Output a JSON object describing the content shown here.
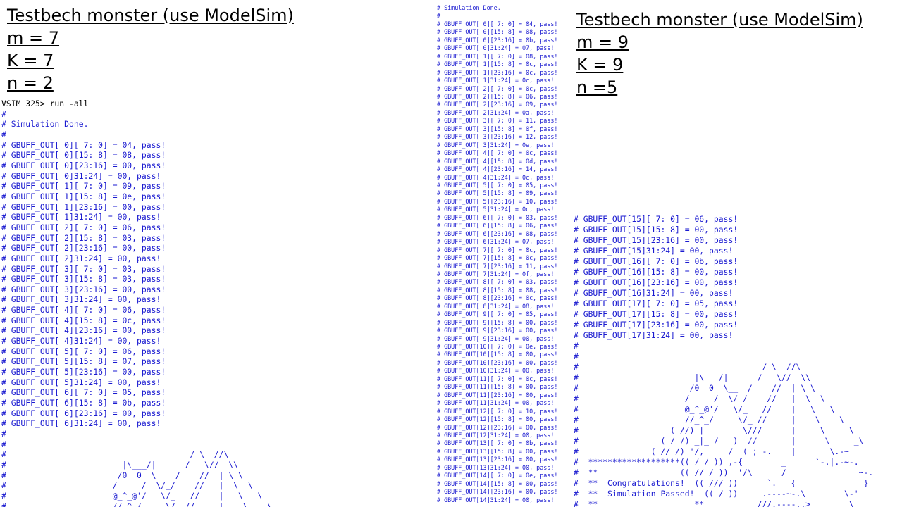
{
  "left": {
    "headings": [
      "Testbech monster (use ModelSim)",
      "m = 7",
      "K = 7",
      "n = 2"
    ],
    "log": [
      "VSIM 325> run -all",
      "#",
      "# Simulation Done.",
      "#",
      "# GBUFF_OUT[ 0][ 7: 0] = 04, pass!",
      "# GBUFF_OUT[ 0][15: 8] = 08, pass!",
      "# GBUFF_OUT[ 0][23:16] = 00, pass!",
      "# GBUFF_OUT[ 0]31:24] = 00, pass!",
      "# GBUFF_OUT[ 1][ 7: 0] = 09, pass!",
      "# GBUFF_OUT[ 1][15: 8] = 0e, pass!",
      "# GBUFF_OUT[ 1][23:16] = 00, pass!",
      "# GBUFF_OUT[ 1]31:24] = 00, pass!",
      "# GBUFF_OUT[ 2][ 7: 0] = 06, pass!",
      "# GBUFF_OUT[ 2][15: 8] = 03, pass!",
      "# GBUFF_OUT[ 2][23:16] = 00, pass!",
      "# GBUFF_OUT[ 2]31:24] = 00, pass!",
      "# GBUFF_OUT[ 3][ 7: 0] = 03, pass!",
      "# GBUFF_OUT[ 3][15: 8] = 03, pass!",
      "# GBUFF_OUT[ 3][23:16] = 00, pass!",
      "# GBUFF_OUT[ 3]31:24] = 00, pass!",
      "# GBUFF_OUT[ 4][ 7: 0] = 06, pass!",
      "# GBUFF_OUT[ 4][15: 8] = 0c, pass!",
      "# GBUFF_OUT[ 4][23:16] = 00, pass!",
      "# GBUFF_OUT[ 4]31:24] = 00, pass!",
      "# GBUFF_OUT[ 5][ 7: 0] = 06, pass!",
      "# GBUFF_OUT[ 5][15: 8] = 07, pass!",
      "# GBUFF_OUT[ 5][23:16] = 00, pass!",
      "# GBUFF_OUT[ 5]31:24] = 00, pass!",
      "# GBUFF_OUT[ 6][ 7: 0] = 05, pass!",
      "# GBUFF_OUT[ 6][15: 8] = 0b, pass!",
      "# GBUFF_OUT[ 6][23:16] = 00, pass!",
      "# GBUFF_OUT[ 6]31:24] = 00, pass!",
      "#",
      "#",
      "#                                      / \\  //\\",
      "#                        |\\___/|      /   \\//  \\\\",
      "#                       /0  0  \\__  /    //  | \\ \\",
      "#                      /     /  \\/_/    //   |  \\  \\",
      "#                      @_^_@'/   \\/_   //    |   \\   \\",
      "#                      //_^_/     \\/_ //     |    \\    \\"
    ]
  },
  "middle": {
    "log": [
      "# Simulation Done.",
      "#",
      "# GBUFF_OUT[ 0][ 7: 0] = 04, pass!",
      "# GBUFF_OUT[ 0][15: 8] = 08, pass!",
      "# GBUFF_OUT[ 0][23:16] = 0b, pass!",
      "# GBUFF_OUT[ 0]31:24] = 07, pass!",
      "# GBUFF_OUT[ 1][ 7: 0] = 08, pass!",
      "# GBUFF_OUT[ 1][15: 8] = 0c, pass!",
      "# GBUFF_OUT[ 1][23:16] = 0c, pass!",
      "# GBUFF_OUT[ 1]31:24] = 0c, pass!",
      "# GBUFF_OUT[ 2][ 7: 0] = 0c, pass!",
      "# GBUFF_OUT[ 2][15: 8] = 06, pass!",
      "# GBUFF_OUT[ 2][23:16] = 09, pass!",
      "# GBUFF_OUT[ 2]31:24] = 0a, pass!",
      "# GBUFF_OUT[ 3][ 7: 0] = 11, pass!",
      "# GBUFF_OUT[ 3][15: 8] = 0f, pass!",
      "# GBUFF_OUT[ 3][23:16] = 12, pass!",
      "# GBUFF_OUT[ 3]31:24] = 0e, pass!",
      "# GBUFF_OUT[ 4][ 7: 0] = 0c, pass!",
      "# GBUFF_OUT[ 4][15: 8] = 0d, pass!",
      "# GBUFF_OUT[ 4][23:16] = 14, pass!",
      "# GBUFF_OUT[ 4]31:24] = 0c, pass!",
      "# GBUFF_OUT[ 5][ 7: 0] = 05, pass!",
      "# GBUFF_OUT[ 5][15: 8] = 09, pass!",
      "# GBUFF_OUT[ 5][23:16] = 10, pass!",
      "# GBUFF_OUT[ 5]31:24] = 0c, pass!",
      "# GBUFF_OUT[ 6][ 7: 0] = 03, pass!",
      "# GBUFF_OUT[ 6][15: 8] = 06, pass!",
      "# GBUFF_OUT[ 6][23:16] = 08, pass!",
      "# GBUFF_OUT[ 6]31:24] = 07, pass!",
      "# GBUFF_OUT[ 7][ 7: 0] = 0c, pass!",
      "# GBUFF_OUT[ 7][15: 8] = 0c, pass!",
      "# GBUFF_OUT[ 7][23:16] = 11, pass!",
      "# GBUFF_OUT[ 7]31:24] = 0f, pass!",
      "# GBUFF_OUT[ 8][ 7: 0] = 03, pass!",
      "# GBUFF_OUT[ 8][15: 8] = 08, pass!",
      "# GBUFF_OUT[ 8][23:16] = 0c, pass!",
      "# GBUFF_OUT[ 8]31:24] = 08, pass!",
      "# GBUFF_OUT[ 9][ 7: 0] = 05, pass!",
      "# GBUFF_OUT[ 9][15: 8] = 00, pass!",
      "# GBUFF_OUT[ 9][23:16] = 00, pass!",
      "# GBUFF_OUT[ 9]31:24] = 00, pass!",
      "# GBUFF_OUT[10][ 7: 0] = 0e, pass!",
      "# GBUFF_OUT[10][15: 8] = 00, pass!",
      "# GBUFF_OUT[10][23:16] = 00, pass!",
      "# GBUFF_OUT[10]31:24] = 00, pass!",
      "# GBUFF_OUT[11][ 7: 0] = 0c, pass!",
      "# GBUFF_OUT[11][15: 8] = 00, pass!",
      "# GBUFF_OUT[11][23:16] = 00, pass!",
      "# GBUFF_OUT[11]31:24] = 00, pass!",
      "# GBUFF_OUT[12][ 7: 0] = 10, pass!",
      "# GBUFF_OUT[12][15: 8] = 00, pass!",
      "# GBUFF_OUT[12][23:16] = 00, pass!",
      "# GBUFF_OUT[12]31:24] = 00, pass!",
      "# GBUFF_OUT[13][ 7: 0] = 0b, pass!",
      "# GBUFF_OUT[13][15: 8] = 00, pass!",
      "# GBUFF_OUT[13][23:16] = 00, pass!",
      "# GBUFF_OUT[13]31:24] = 00, pass!",
      "# GBUFF_OUT[14][ 7: 0] = 0e, pass!",
      "# GBUFF_OUT[14][15: 8] = 00, pass!",
      "# GBUFF_OUT[14][23:16] = 00, pass!",
      "# GBUFF_OUT[14]31:24] = 00, pass!"
    ]
  },
  "right": {
    "headings": [
      "Testbech monster (use ModelSim)",
      "m = 9",
      "K = 9",
      "n =5"
    ],
    "log": [
      "# GBUFF_OUT[15][ 7: 0] = 06, pass!",
      "# GBUFF_OUT[15][15: 8] = 00, pass!",
      "# GBUFF_OUT[15][23:16] = 00, pass!",
      "# GBUFF_OUT[15]31:24] = 00, pass!",
      "# GBUFF_OUT[16][ 7: 0] = 0b, pass!",
      "# GBUFF_OUT[16][15: 8] = 00, pass!",
      "# GBUFF_OUT[16][23:16] = 00, pass!",
      "# GBUFF_OUT[16]31:24] = 00, pass!",
      "# GBUFF_OUT[17][ 7: 0] = 05, pass!",
      "# GBUFF_OUT[17][15: 8] = 00, pass!",
      "# GBUFF_OUT[17][23:16] = 00, pass!",
      "# GBUFF_OUT[17]31:24] = 00, pass!",
      "#",
      "#",
      "#                                      / \\  //\\",
      "#                        |\\___/|      /   \\//  \\\\",
      "#                       /0  0  \\__  /    //  | \\ \\",
      "#                      /     /  \\/_/    //   |  \\  \\",
      "#                      @_^_@'/   \\/_   //    |   \\   \\",
      "#                      //_^_/     \\/_ //     |    \\    \\",
      "#                   ( //) |        \\///      |     \\     \\",
      "#                 ( / /) _|_ /   )  //       |      \\     _\\",
      "#               ( // /) '/,_ _ _/  ( ; -.    |    _ _\\.-~",
      "#  *******************(( / / )) ,-{        _      `-.|.-~-.",
      "#  **                 (( // / ))  '/\\      /               ~-.",
      "#  **  Congratulations!  (( /// ))      `.   {              }",
      "#  **  Simulation Passed!  (( / ))     .----~-.\\        \\-'",
      "#  **                    **           ///.----..>        \\"
    ]
  }
}
